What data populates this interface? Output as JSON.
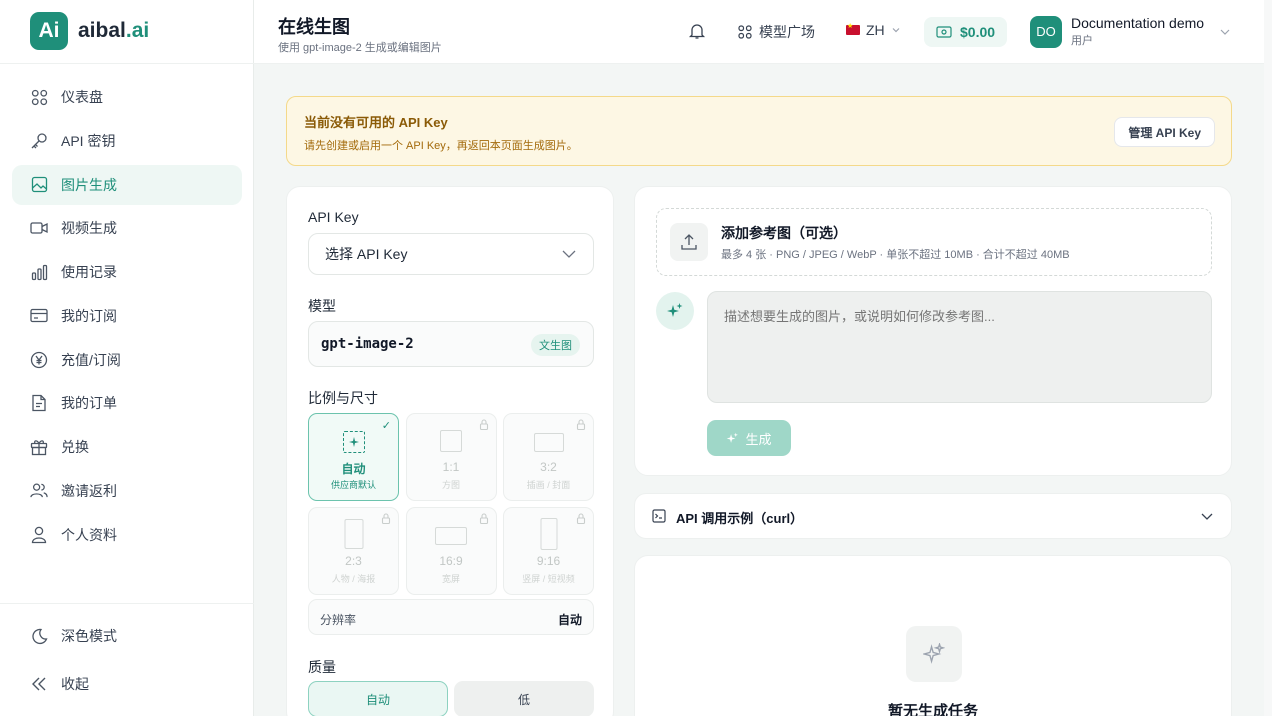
{
  "brand": {
    "logo": "Ai",
    "name": "aibal",
    "suffix": ".ai"
  },
  "sidebar": {
    "items": [
      {
        "label": "仪表盘",
        "icon": "grid-icon"
      },
      {
        "label": "API 密钥",
        "icon": "key-icon"
      },
      {
        "label": "图片生成",
        "icon": "image-icon",
        "active": true
      },
      {
        "label": "视频生成",
        "icon": "video-icon"
      },
      {
        "label": "使用记录",
        "icon": "bar-chart-icon"
      },
      {
        "label": "我的订阅",
        "icon": "card-icon"
      },
      {
        "label": "充值/订阅",
        "icon": "yen-circle-icon"
      },
      {
        "label": "我的订单",
        "icon": "document-icon"
      },
      {
        "label": "兑换",
        "icon": "gift-icon"
      },
      {
        "label": "邀请返利",
        "icon": "users-icon"
      },
      {
        "label": "个人资料",
        "icon": "user-icon"
      }
    ],
    "bottom": [
      {
        "label": "深色模式",
        "icon": "moon-icon"
      },
      {
        "label": "收起",
        "icon": "double-chevron-left-icon"
      }
    ]
  },
  "header": {
    "title": "在线生图",
    "subtitle": "使用 gpt-image-2 生成或编辑图片",
    "market": "模型广场",
    "lang": "ZH",
    "balance": "$0.00",
    "user": {
      "initials": "DO",
      "name": "Documentation demo",
      "role": "用户"
    }
  },
  "warning": {
    "title": "当前没有可用的 API Key",
    "desc": "请先创建或启用一个 API Key，再返回本页面生成图片。",
    "button": "管理 API Key"
  },
  "form": {
    "api_key_label": "API Key",
    "api_key_select": "选择 API Key",
    "model_label": "模型",
    "model_name": "gpt-image-2",
    "model_badge": "文生图",
    "ratio_label": "比例与尺寸",
    "ratios": [
      {
        "label": "自动",
        "sub": "供应商默认"
      },
      {
        "label": "1:1",
        "sub": "方图"
      },
      {
        "label": "3:2",
        "sub": "插画 / 封面"
      },
      {
        "label": "2:3",
        "sub": "人物 / 海报"
      },
      {
        "label": "16:9",
        "sub": "宽屏"
      },
      {
        "label": "9:16",
        "sub": "竖屏 / 短视频"
      }
    ],
    "resolution_label": "分辨率",
    "resolution_value": "自动",
    "quality_label": "质量",
    "quality_auto": "自动",
    "quality_low": "低"
  },
  "generate": {
    "upload_title": "添加参考图（可选）",
    "upload_desc": "最多 4 张 · PNG / JPEG / WebP · 单张不超过 10MB · 合计不超过 40MB",
    "prompt_placeholder": "描述想要生成的图片，或说明如何修改参考图...",
    "button": "生成"
  },
  "curl": {
    "label": "API 调用示例（curl）"
  },
  "tasks": {
    "empty": "暂无生成任务"
  },
  "colors": {
    "accent": "#1f8f7a",
    "warning_bg": "#fdf7e4",
    "warning_text": "#8a5a06"
  }
}
